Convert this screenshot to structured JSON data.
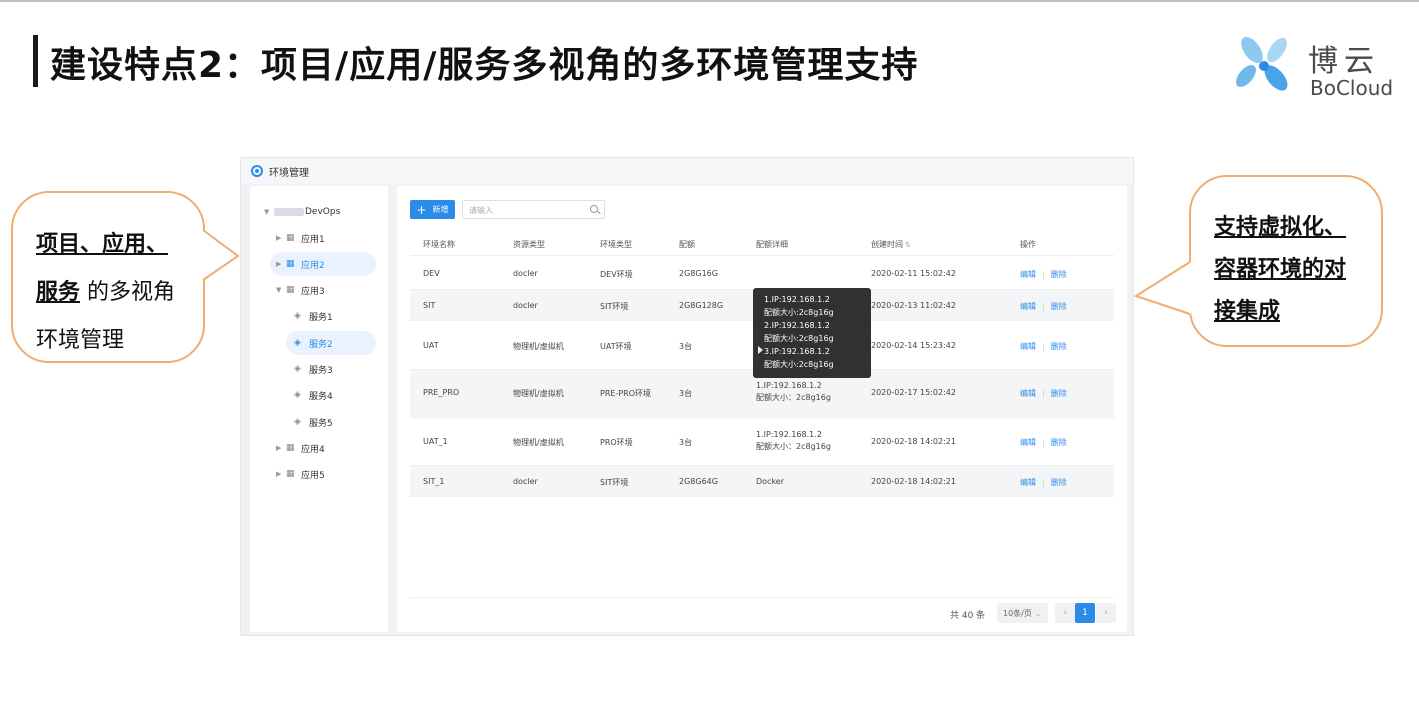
{
  "slide": {
    "title": "建设特点2：项目/应用/服务多视角的多环境管理支持",
    "logo": {
      "cn": "博云",
      "en": "BoCloud"
    }
  },
  "colors": {
    "accent": "#2a8be8",
    "callout_border": "#f0ad6e",
    "tooltip_bg": "#303133"
  },
  "app": {
    "title": "环境管理",
    "title_icon": "gear-icon",
    "tree": {
      "root": "DevOps",
      "items": [
        {
          "label": "应用1",
          "level": 1,
          "icon": "app-grid-icon",
          "selected": false
        },
        {
          "label": "应用2",
          "level": 1,
          "icon": "app-grid-icon",
          "selected": true
        },
        {
          "label": "应用3",
          "level": 1,
          "icon": "app-grid-icon",
          "selected": false,
          "expanded": true
        },
        {
          "label": "服务1",
          "level": 2,
          "icon": "layers-icon",
          "selected": false
        },
        {
          "label": "服务2",
          "level": 2,
          "icon": "layers-icon",
          "selected": true
        },
        {
          "label": "服务3",
          "level": 2,
          "icon": "layers-icon",
          "selected": false
        },
        {
          "label": "服务4",
          "level": 2,
          "icon": "layers-icon",
          "selected": false
        },
        {
          "label": "服务5",
          "level": 2,
          "icon": "layers-icon",
          "selected": false
        },
        {
          "label": "应用4",
          "level": 1,
          "icon": "app-grid-icon",
          "selected": false
        },
        {
          "label": "应用5",
          "level": 1,
          "icon": "app-grid-icon",
          "selected": false
        }
      ]
    },
    "toolbar": {
      "add_label": "新增",
      "search_placeholder": "请输入"
    },
    "table": {
      "headers": [
        "环境名称",
        "资源类型",
        "环境类型",
        "配额",
        "配额详细",
        "创建时间",
        "操作"
      ],
      "rows": [
        {
          "name": "DEV",
          "resource": "docler",
          "env_type": "DEV环境",
          "quota": "2G8G16G",
          "detail": [
            "",
            ""
          ],
          "created": "2020-02-11   15:02:42"
        },
        {
          "name": "SIT",
          "resource": "docler",
          "env_type": "SIT环境",
          "quota": "2G8G128G",
          "detail": [
            "",
            ""
          ],
          "created": "2020-02-13   11:02:42"
        },
        {
          "name": "UAT",
          "resource": "物理机/虚拟机",
          "env_type": "UAT环境",
          "quota": "3台",
          "detail": [
            "",
            ""
          ],
          "created": "2020-02-14   15:23:42"
        },
        {
          "name": "PRE_PRO",
          "resource": "物理机/虚拟机",
          "env_type": "PRE-PRO环境",
          "quota": "3台",
          "detail": [
            "1.IP:192.168.1.2",
            "配额大小：2c8g16g"
          ],
          "created": "2020-02-17   15:02:42"
        },
        {
          "name": "UAT_1",
          "resource": "物理机/虚拟机",
          "env_type": "PRO环境",
          "quota": "3台",
          "detail": [
            "1.IP:192.168.1.2",
            "配额大小：2c8g16g"
          ],
          "created": "2020-02-18   14:02:21"
        },
        {
          "name": "SIT_1",
          "resource": "docler",
          "env_type": "SIT环境",
          "quota": "2G8G64G",
          "detail": [
            "Docker",
            ""
          ],
          "created": "2020-02-18   14:02:21"
        }
      ],
      "edit_label": "编辑",
      "delete_label": "删除"
    },
    "tooltip": {
      "lines": [
        "1.IP:192.168.1.2",
        "配额大小:2c8g16g",
        "2.IP:192.168.1.2",
        "配额大小:2c8g16g",
        "3.IP:192.168.1.2",
        "配额大小:2c8g16g"
      ]
    },
    "pagination": {
      "total": "共 40 条",
      "page_size": "10条/页",
      "current": "1",
      "prev": "‹",
      "next": "›"
    }
  },
  "callouts": {
    "left": {
      "line1": "项目、应用、",
      "line2_bold": "服务",
      "line2_rest": " 的多视角",
      "line3": "环境管理"
    },
    "right": {
      "line1": "支持虚拟化、",
      "line2": "容器环境的对",
      "line3": "接集成"
    }
  }
}
